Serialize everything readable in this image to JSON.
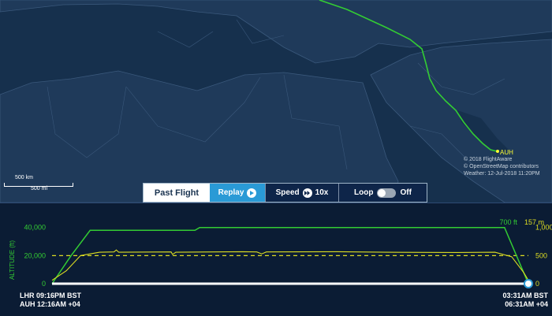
{
  "map": {
    "airport_label": "AUH",
    "attribution": [
      "© 2018 FlightAware",
      "© OpenStreetMap contributors",
      "Weather: 12-Jul-2018 11:20PM"
    ],
    "scale": {
      "km": "500 km",
      "mi": "500 mi"
    },
    "colors": {
      "land": "#1f3a5a",
      "sea": "#16304d",
      "border": "#3a587b",
      "route": "#33cc33"
    }
  },
  "controls": {
    "past_flight": "Past Flight",
    "replay": "Replay",
    "speed_label": "Speed",
    "speed_value": "10x",
    "loop_label": "Loop",
    "loop_state": "Off"
  },
  "chart_data": {
    "type": "line",
    "ylabel_left": "ALTITUDE (ft)",
    "altitude_axis": {
      "ticks": [
        "0",
        "20,000",
        "40,000"
      ],
      "range": [
        0,
        46000
      ],
      "max_label": "700 ft"
    },
    "speed_axis": {
      "ticks": [
        "0",
        "500",
        "1,000"
      ],
      "range": [
        0,
        1150
      ],
      "max_label": "157 m"
    },
    "series": [
      {
        "label": "Altitude",
        "color": "#33cc33",
        "points": [
          [
            0,
            0
          ],
          [
            0.04,
            20000
          ],
          [
            0.08,
            38000
          ],
          [
            0.3,
            38000
          ],
          [
            0.31,
            40000
          ],
          [
            0.95,
            40000
          ],
          [
            0.99,
            8000
          ],
          [
            1,
            0
          ]
        ]
      },
      {
        "label": "Speed",
        "color": "#dddd22",
        "points": [
          [
            0,
            60
          ],
          [
            0.03,
            230
          ],
          [
            0.06,
            500
          ],
          [
            0.1,
            560
          ],
          [
            0.13,
            565
          ],
          [
            0.135,
            600
          ],
          [
            0.14,
            560
          ],
          [
            0.25,
            565
          ],
          [
            0.253,
            520
          ],
          [
            0.26,
            560
          ],
          [
            0.4,
            570
          ],
          [
            0.43,
            565
          ],
          [
            0.44,
            530
          ],
          [
            0.45,
            565
          ],
          [
            0.6,
            570
          ],
          [
            0.7,
            560
          ],
          [
            0.85,
            555
          ],
          [
            0.93,
            560
          ],
          [
            0.965,
            480
          ],
          [
            0.99,
            200
          ],
          [
            1,
            60
          ]
        ]
      }
    ],
    "reference_line": 500
  },
  "footer": {
    "dep_line1": "LHR 09:16PM BST",
    "dep_line2": "AUH 12:16AM +04",
    "arr_line1": "03:31AM BST",
    "arr_line2": "06:31AM +04"
  }
}
